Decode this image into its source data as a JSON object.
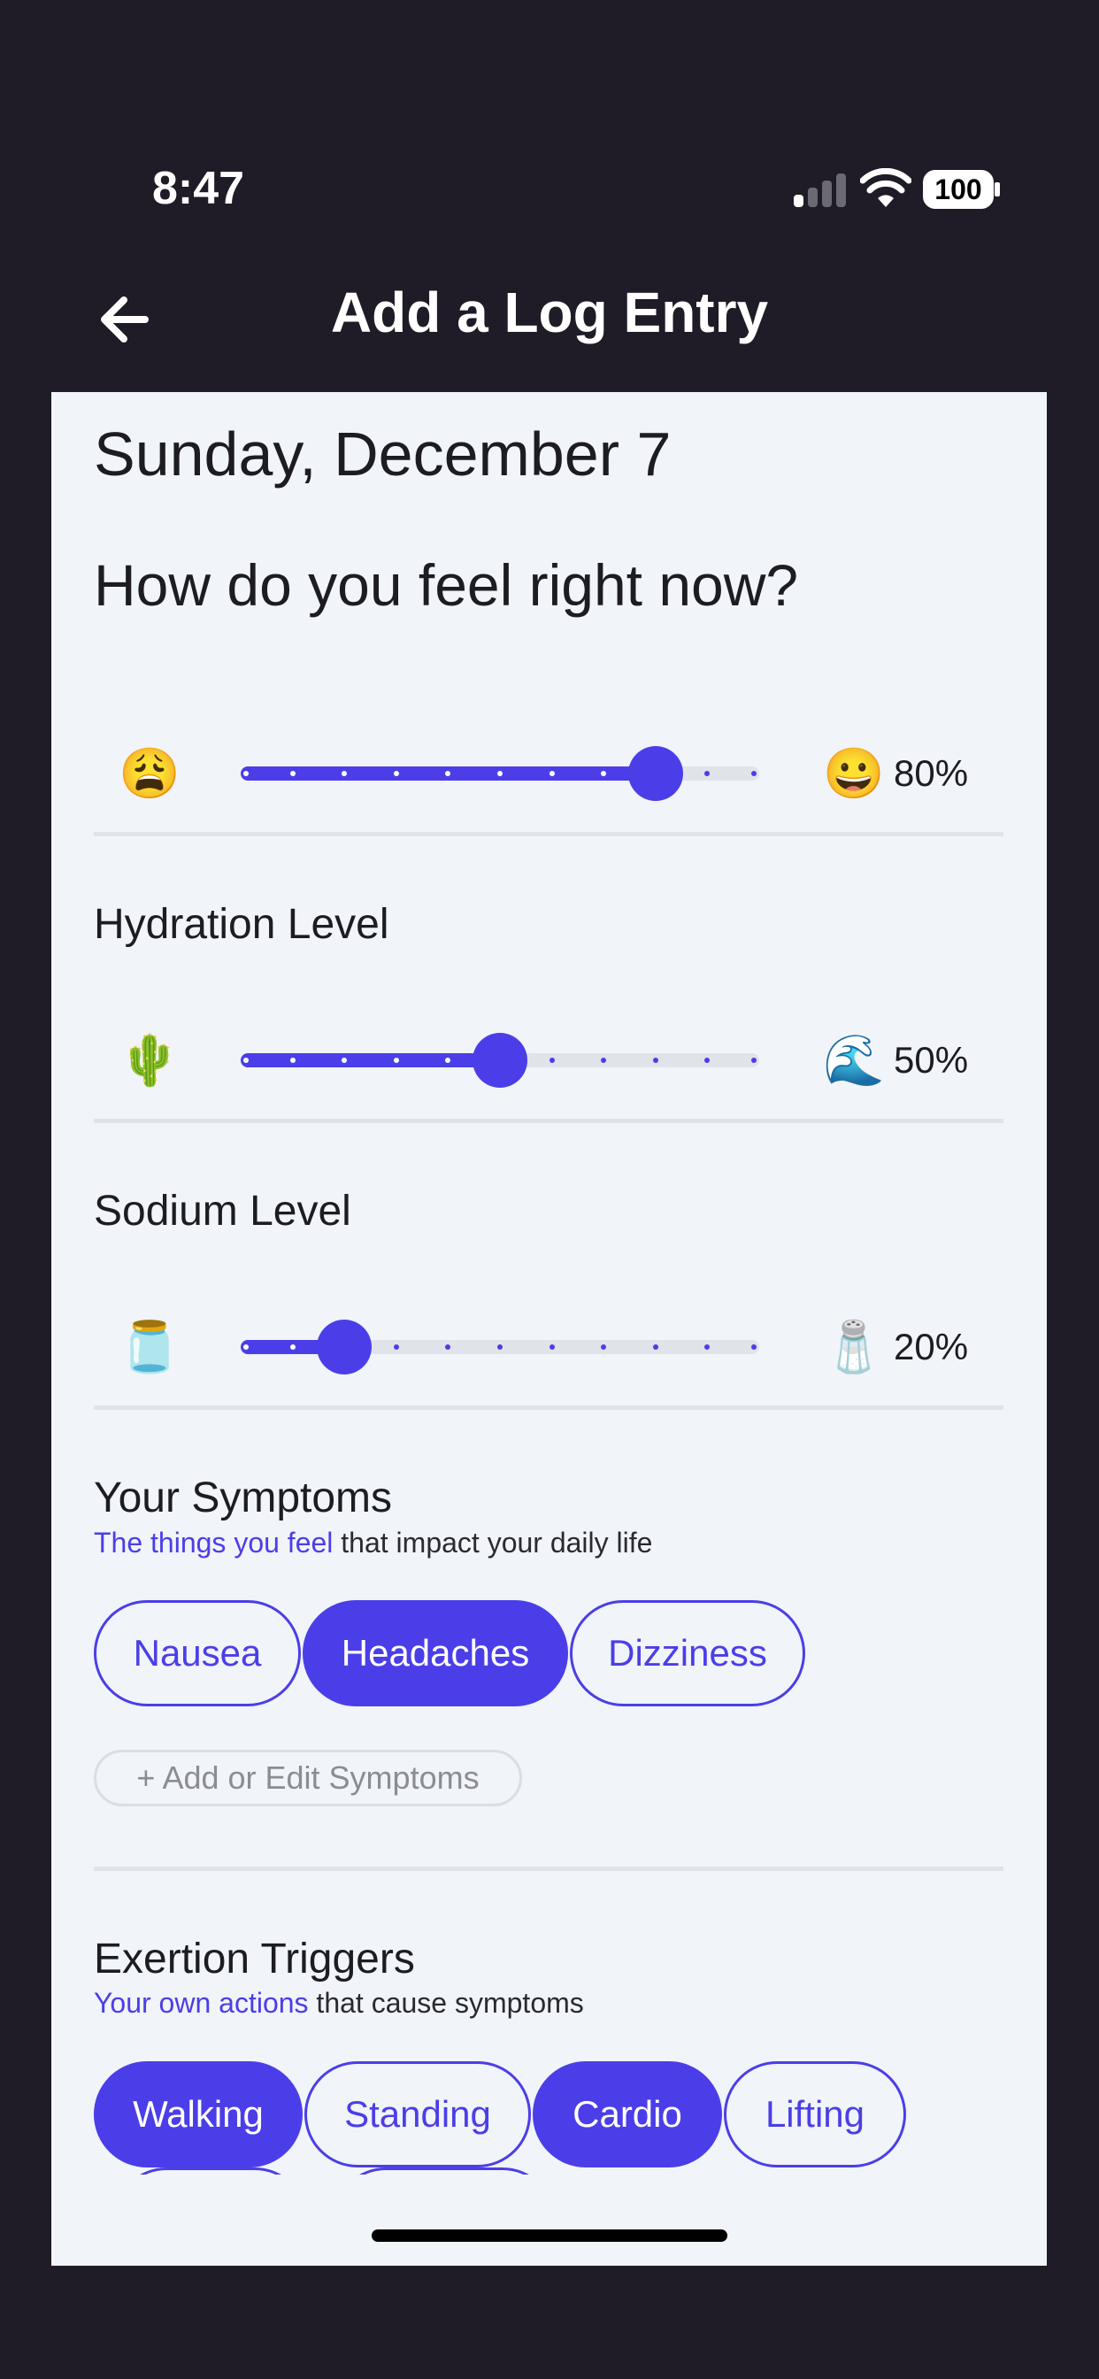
{
  "status_bar": {
    "time": "8:47",
    "battery": "100"
  },
  "nav": {
    "title": "Add a Log Entry",
    "back_icon": "arrow-left-icon"
  },
  "date": "Sunday, December 7",
  "question": "How do you feel right now?",
  "accent_color": "#4b3ee8",
  "sliders": [
    {
      "label": "",
      "left_icon": "😩",
      "right_icon": "😀",
      "value_text": "80%",
      "value": 80,
      "steps": 10
    },
    {
      "label": "Hydration Level",
      "left_icon": "🌵",
      "right_icon": "🌊",
      "value_text": "50%",
      "value": 50,
      "steps": 10
    },
    {
      "label": "Sodium Level",
      "left_icon": "🫙",
      "right_icon": "🧂",
      "value_text": "20%",
      "value": 20,
      "steps": 10
    }
  ],
  "symptoms": {
    "title": "Your Symptoms",
    "subtitle_accent": "The things you feel",
    "subtitle_rest": " that impact your daily life",
    "chips": [
      {
        "label": "Nausea",
        "selected": false
      },
      {
        "label": "Headaches",
        "selected": true
      },
      {
        "label": "Dizziness",
        "selected": false
      }
    ],
    "add_label": "+ Add or Edit Symptoms"
  },
  "triggers": {
    "title": "Exertion Triggers",
    "subtitle_accent": "Your own actions",
    "subtitle_rest": " that cause symptoms",
    "chips": [
      {
        "label": "Walking",
        "selected": true
      },
      {
        "label": "Standing",
        "selected": false
      },
      {
        "label": "Cardio",
        "selected": true
      },
      {
        "label": "Lifting",
        "selected": false
      }
    ]
  }
}
